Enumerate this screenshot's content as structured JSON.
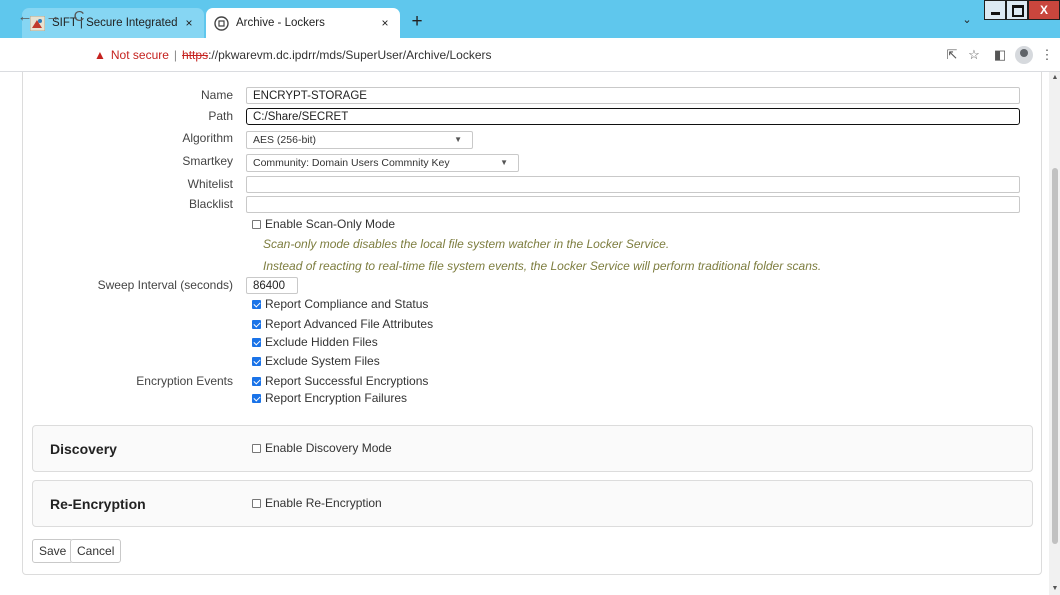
{
  "browser": {
    "tabs": [
      {
        "title": "SIFT | Secure Integrated File Tagg",
        "active": false
      },
      {
        "title": "Archive - Lockers",
        "active": true
      }
    ],
    "new_tab_symbol": "+",
    "close_symbol": "×",
    "window_close_symbol": "X",
    "address": {
      "warning": "Not secure",
      "separator": "|",
      "scheme": "https",
      "rest": "://pkwarevm.dc.ipdrr/mds/SuperUser/Archive/Lockers"
    }
  },
  "form": {
    "name": {
      "label": "Name",
      "value": "ENCRYPT-STORAGE"
    },
    "path": {
      "label": "Path",
      "value": "C:/Share/SECRET"
    },
    "algorithm": {
      "label": "Algorithm",
      "selected": "AES (256-bit)"
    },
    "smartkey": {
      "label": "Smartkey",
      "selected": "Community: Domain Users Commnity Key"
    },
    "whitelist": {
      "label": "Whitelist",
      "value": ""
    },
    "blacklist": {
      "label": "Blacklist",
      "value": ""
    },
    "scan_only": {
      "label": "Enable Scan-Only Mode",
      "checked": false,
      "notes": [
        "Scan-only mode disables the local file system watcher in the Locker Service.",
        "Instead of reacting to real-time file system events, the Locker Service will perform traditional folder scans."
      ]
    },
    "sweep_interval": {
      "label": "Sweep Interval (seconds)",
      "value": "86400"
    },
    "options": [
      {
        "label": "Report Compliance and Status",
        "checked": true
      },
      {
        "label": "Report Advanced File Attributes",
        "checked": true
      },
      {
        "label": "Exclude Hidden Files",
        "checked": true
      },
      {
        "label": "Exclude System Files",
        "checked": true
      }
    ],
    "encryption_events": {
      "label": "Encryption Events",
      "options": [
        {
          "label": "Report Successful Encryptions",
          "checked": true
        },
        {
          "label": "Report Encryption Failures",
          "checked": true
        }
      ]
    }
  },
  "sections": {
    "discovery": {
      "title": "Discovery",
      "checkbox_label": "Enable Discovery Mode",
      "checked": false
    },
    "reencryption": {
      "title": "Re-Encryption",
      "checkbox_label": "Enable Re-Encryption",
      "checked": false
    }
  },
  "actions": {
    "save": "Save",
    "cancel": "Cancel"
  },
  "colors": {
    "titlebar": "#5fc7ed",
    "checkbox_checked": "#1a73e8",
    "note_text": "#7d7d3f",
    "insecure": "#c5221f"
  }
}
